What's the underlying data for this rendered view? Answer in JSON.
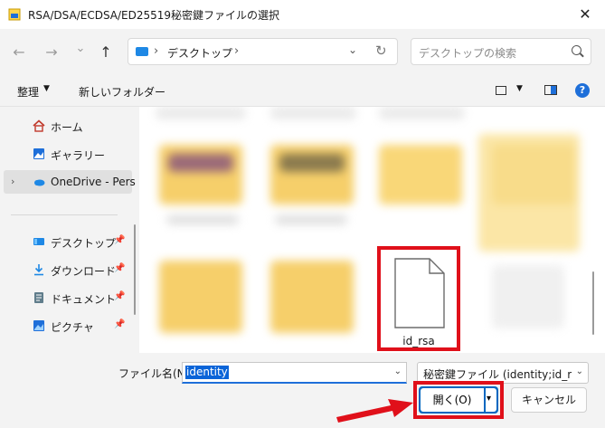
{
  "window": {
    "title": "RSA/DSA/ECDSA/ED25519秘密鍵ファイルの選択",
    "close_glyph": "✕"
  },
  "nav": {
    "back_glyph": "←",
    "forward_glyph": "→",
    "recent_glyph": "⌄",
    "up_glyph": "↑",
    "breadcrumb": "デスクトップ",
    "sep_glyph": "›",
    "dropdown_glyph": "⌄",
    "refresh_glyph": "↻",
    "search_placeholder": "デスクトップの検索"
  },
  "toolbar": {
    "organize_label": "整理",
    "organize_caret": "▼",
    "new_folder_label": "新しいフォルダー",
    "view_caret": "▼",
    "help_glyph": "?"
  },
  "sidebar": {
    "expand_glyph": "›",
    "pin_glyph": "📌",
    "items": [
      {
        "label": "ホーム"
      },
      {
        "label": "ギャラリー"
      },
      {
        "label": "OneDrive - Pers"
      },
      {
        "label": "デスクトップ"
      },
      {
        "label": "ダウンロード"
      },
      {
        "label": "ドキュメント"
      },
      {
        "label": "ピクチャ"
      }
    ]
  },
  "content": {
    "selected_file": "id_rsa"
  },
  "footer": {
    "filename_label": "ファイル名(N):",
    "filename_value": "identity",
    "filename_drop": "⌄",
    "filter_value": "秘密鍵ファイル (identity;id_rsa;id_",
    "filter_drop": "⌄",
    "open_label": "開く(O)",
    "open_caret": "▾",
    "cancel_label": "キャンセル"
  },
  "colors": {
    "annotation_red": "#e0101a",
    "accent_blue": "#0067c0"
  }
}
